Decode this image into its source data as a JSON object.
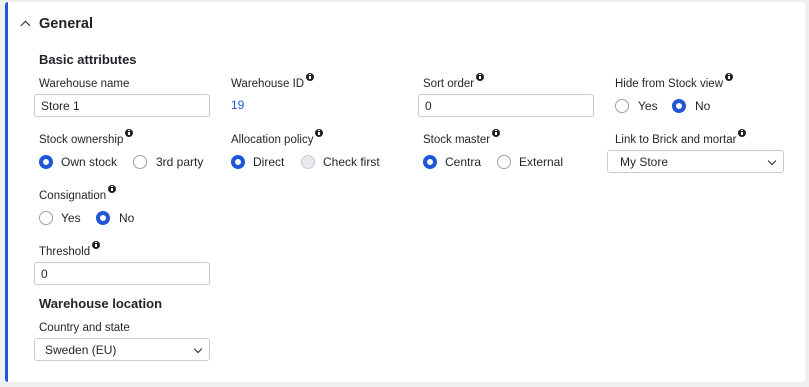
{
  "section": {
    "title": "General"
  },
  "basic": {
    "title": "Basic attributes",
    "warehouse_name": {
      "label": "Warehouse name",
      "value": "Store 1"
    },
    "warehouse_id": {
      "label": "Warehouse ID",
      "value": "19"
    },
    "sort_order": {
      "label": "Sort order",
      "value": "0"
    },
    "hide_from_stock": {
      "label": "Hide from Stock view",
      "options": [
        "Yes",
        "No"
      ],
      "selected": "No"
    },
    "stock_ownership": {
      "label": "Stock ownership",
      "options": [
        "Own stock",
        "3rd party"
      ],
      "selected": "Own stock"
    },
    "allocation_policy": {
      "label": "Allocation policy",
      "options": [
        "Direct",
        "Check first"
      ],
      "selected": "Direct"
    },
    "stock_master": {
      "label": "Stock master",
      "options": [
        "Centra",
        "External"
      ],
      "selected": "Centra"
    },
    "link_brick": {
      "label": "Link to Brick and mortar",
      "value": "My Store"
    },
    "consignation": {
      "label": "Consignation",
      "options": [
        "Yes",
        "No"
      ],
      "selected": "No"
    },
    "threshold": {
      "label": "Threshold",
      "value": "0"
    }
  },
  "location": {
    "title": "Warehouse location",
    "country_state": {
      "label": "Country and state",
      "value": "Sweden (EU)"
    }
  },
  "colors": {
    "accent": "#1f57d6",
    "text": "#1f2328",
    "border": "#c7ccd1"
  },
  "icons": [
    "chevron-up-icon",
    "info-icon",
    "chevron-down-icon"
  ]
}
